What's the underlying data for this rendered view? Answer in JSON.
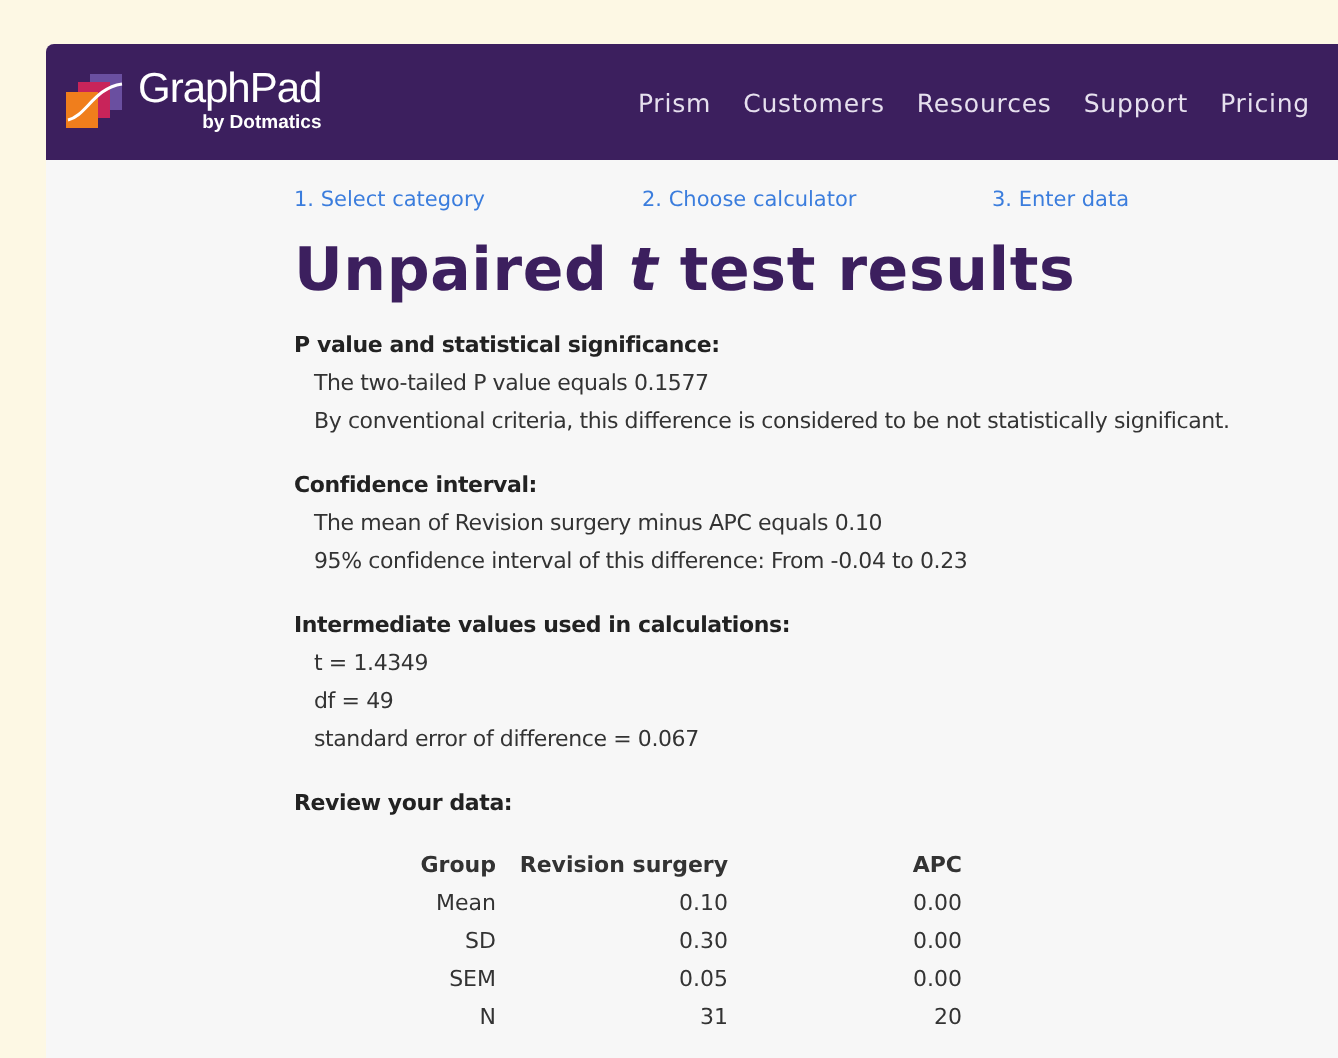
{
  "header": {
    "logo_name": "GraphPad",
    "logo_byline": "by Dotmatics",
    "nav": [
      "Prism",
      "Customers",
      "Resources",
      "Support",
      "Pricing"
    ]
  },
  "steps": [
    "1. Select category",
    "2. Choose calculator",
    "3. Enter data"
  ],
  "title": "Unpaired *t* test results",
  "sections": [
    {
      "heading": "P value and statistical significance:",
      "lines": [
        "The two-tailed P value equals 0.1577",
        "By conventional criteria, this difference is considered to be not statistically significant."
      ]
    },
    {
      "heading": "Confidence interval:",
      "lines": [
        "The mean of Revision surgery minus APC equals 0.10",
        "95% confidence interval of this difference: From -0.04 to 0.23"
      ]
    },
    {
      "heading": "Intermediate values used in calculations:",
      "lines": [
        "t = 1.4349",
        "df = 49",
        "standard error of difference = 0.067"
      ]
    }
  ],
  "review": {
    "heading": "Review your data:",
    "columns": [
      "Group",
      "Revision surgery",
      "APC"
    ],
    "rows": [
      [
        "Mean",
        "0.10",
        "0.00"
      ],
      [
        "SD",
        "0.30",
        "0.00"
      ],
      [
        "SEM",
        "0.05",
        "0.00"
      ],
      [
        "N",
        "31",
        "20"
      ]
    ]
  }
}
